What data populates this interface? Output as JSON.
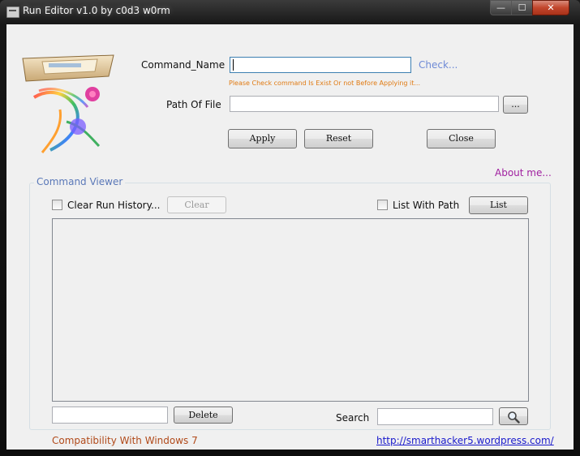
{
  "window": {
    "title": "Run Editor v1.0 by c0d3 w0rm"
  },
  "controls": {
    "minimize": "—",
    "maximize": "☐",
    "close": "✕"
  },
  "form": {
    "command_label": "Command_Name",
    "command_value": "",
    "check_link": "Check...",
    "hint": "Please Check command Is Exist Or not Before Applying it...",
    "path_label": "Path Of File",
    "path_value": "",
    "browse_label": "..."
  },
  "actions": {
    "apply": "Apply",
    "reset": "Reset",
    "close": "Close"
  },
  "about_link": "About me...",
  "viewer": {
    "title": "Command Viewer",
    "clear_history_label": "Clear Run History...",
    "clear_history_checked": false,
    "clear_button": "Clear",
    "list_with_path_label": "List With Path",
    "list_with_path_checked": false,
    "list_button": "List",
    "delete_value": "",
    "delete_button": "Delete",
    "search_label": "Search",
    "search_value": ""
  },
  "footer": {
    "compatibility": "Compatibility With Windows 7",
    "website": "http://smarthacker5.wordpress.com/"
  },
  "icons": {
    "search": "magnifier-icon",
    "app": "window-icon",
    "logo": "running-figure-logo"
  }
}
